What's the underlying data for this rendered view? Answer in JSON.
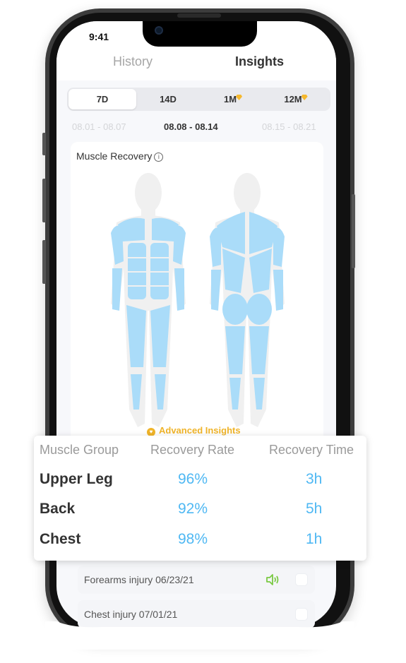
{
  "status_bar": {
    "time": "9:41"
  },
  "tabs": [
    {
      "label": "History",
      "active": false
    },
    {
      "label": "Insights",
      "active": true
    }
  ],
  "period_selector": {
    "options": [
      {
        "label": "7D",
        "active": true,
        "premium": false
      },
      {
        "label": "14D",
        "active": false,
        "premium": false
      },
      {
        "label": "1M",
        "active": false,
        "premium": true
      },
      {
        "label": "12M",
        "active": false,
        "premium": true
      }
    ]
  },
  "date_ranges": {
    "previous": "08.01 - 08.07",
    "current": "08.08 - 08.14",
    "next": "08.15 - 08.21"
  },
  "muscle_recovery": {
    "title": "Muscle Recovery",
    "info_icon": "info-icon",
    "advanced_link": "Advanced Insights",
    "muscle_color": "#aadcf9",
    "body_color": "#f0f0f0"
  },
  "recovery_table": {
    "headers": [
      "Muscle Group",
      "Recovery Rate",
      "Recovery Time"
    ],
    "rows": [
      {
        "group": "Upper Leg",
        "rate": "96%",
        "time": "3h"
      },
      {
        "group": "Back",
        "rate": "92%",
        "time": "5h"
      },
      {
        "group": "Chest",
        "rate": "98%",
        "time": "1h"
      }
    ],
    "value_color": "#4fb8f3"
  },
  "injury_list": [
    {
      "label": "Forearms injury 06/23/21",
      "has_audio": true
    },
    {
      "label": "Chest injury 07/01/21",
      "has_audio": false
    }
  ]
}
